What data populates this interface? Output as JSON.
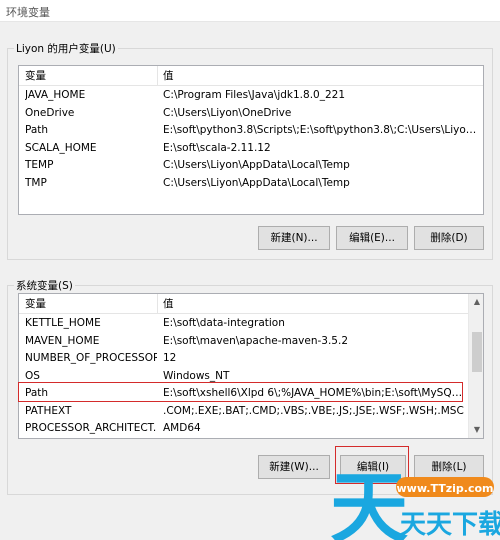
{
  "window": {
    "title": "环境变量"
  },
  "user_vars": {
    "legend": "Liyon 的用户变量(U)",
    "columns": [
      "变量",
      "值"
    ],
    "rows": [
      {
        "name": "JAVA_HOME",
        "value": "C:\\Program Files\\Java\\jdk1.8.0_221"
      },
      {
        "name": "OneDrive",
        "value": "C:\\Users\\Liyon\\OneDrive"
      },
      {
        "name": "Path",
        "value": "E:\\soft\\python3.8\\Scripts\\;E:\\soft\\python3.8\\;C:\\Users\\Liyon\\App..."
      },
      {
        "name": "SCALA_HOME",
        "value": "E:\\soft\\scala-2.11.12"
      },
      {
        "name": "TEMP",
        "value": "C:\\Users\\Liyon\\AppData\\Local\\Temp"
      },
      {
        "name": "TMP",
        "value": "C:\\Users\\Liyon\\AppData\\Local\\Temp"
      }
    ],
    "buttons": {
      "new": "新建(N)...",
      "edit": "编辑(E)...",
      "delete": "删除(D)"
    }
  },
  "system_vars": {
    "legend": "系统变量(S)",
    "columns": [
      "变量",
      "值"
    ],
    "rows": [
      {
        "name": "KETTLE_HOME",
        "value": "E:\\soft\\data-integration"
      },
      {
        "name": "MAVEN_HOME",
        "value": "E:\\soft\\maven\\apache-maven-3.5.2"
      },
      {
        "name": "NUMBER_OF_PROCESSORS",
        "value": "12"
      },
      {
        "name": "OS",
        "value": "Windows_NT"
      },
      {
        "name": "Path",
        "value": "E:\\soft\\xshell6\\Xlpd 6\\;%JAVA_HOME%\\bin;E:\\soft\\MySQL\\M..."
      },
      {
        "name": "PATHEXT",
        "value": ".COM;.EXE;.BAT;.CMD;.VBS;.VBE;.JS;.JSE;.WSF;.WSH;.MSC"
      },
      {
        "name": "PROCESSOR_ARCHITECT...",
        "value": "AMD64"
      }
    ],
    "buttons": {
      "new": "新建(W)...",
      "edit": "编辑(I)",
      "delete": "删除(L)"
    }
  },
  "watermark": {
    "url": "www.TTzip.com",
    "brand": "天天下载",
    "glyph": "天"
  },
  "colors": {
    "highlight": "#d42b2b",
    "watermark_blue": "#1aa7e0",
    "watermark_orange": "#f08a1c"
  }
}
